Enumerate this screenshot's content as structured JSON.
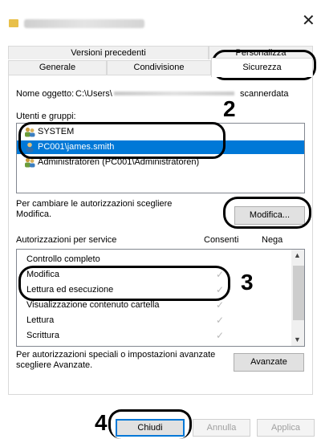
{
  "window": {
    "close_glyph": "✕"
  },
  "tabs": {
    "row1": [
      "Versioni precedenti",
      "Personalizza"
    ],
    "row2": [
      "Generale",
      "Condivisione",
      "Sicurezza"
    ]
  },
  "object": {
    "label": "Nome oggetto:",
    "path_prefix": "C:\\Users\\",
    "path_suffix": "scannerdata"
  },
  "groups": {
    "label": "Utenti e gruppi:",
    "items": [
      {
        "name": "SYSTEM",
        "icon": "users-group-icon",
        "selected": false
      },
      {
        "name": "PC001\\james.smith",
        "icon": "user-icon",
        "selected": true
      },
      {
        "name": "Administratoren (PC001\\Administratoren)",
        "icon": "users-group-icon",
        "selected": false
      }
    ]
  },
  "change_hint": "Per cambiare le autorizzazioni scegliere Modifica.",
  "modify_button": "Modifica...",
  "permissions": {
    "header": "Autorizzazioni per service",
    "allow_col": "Consenti",
    "deny_col": "Nega",
    "rows": [
      {
        "name": "Controllo completo",
        "allow": false
      },
      {
        "name": "Modifica",
        "allow": true
      },
      {
        "name": "Lettura ed esecuzione",
        "allow": true
      },
      {
        "name": "Visualizzazione contenuto cartella",
        "allow": true
      },
      {
        "name": "Lettura",
        "allow": true
      },
      {
        "name": "Scrittura",
        "allow": true
      }
    ]
  },
  "advanced_hint": "Per autorizzazioni speciali o impostazioni avanzate scegliere Avanzate.",
  "advanced_button": "Avanzate",
  "footer": {
    "close": "Chiudi",
    "cancel": "Annulla",
    "apply": "Applica"
  },
  "callouts": {
    "two": "2",
    "three": "3",
    "four": "4"
  },
  "colors": {
    "selection": "#0078d7",
    "check": "#b8b8b8"
  }
}
